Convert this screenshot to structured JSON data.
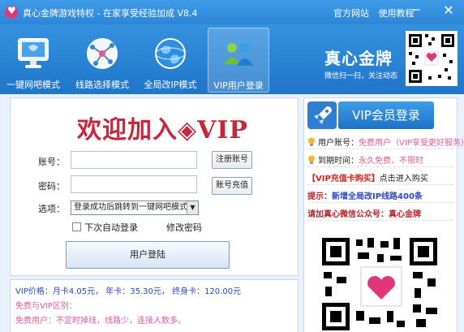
{
  "window": {
    "title": "真心金牌游戏特权 - 在家享受经验加成 V8.4",
    "links": [
      "官方网站",
      "使用教程"
    ],
    "minimize_glyph": "─",
    "close_glyph": "✕"
  },
  "toolbar": {
    "items": [
      {
        "label": "一键网吧模式",
        "icon": "monitor-icon"
      },
      {
        "label": "线路选择模式",
        "icon": "route-nodes-icon"
      },
      {
        "label": "全局改IP模式",
        "icon": "globe-icon"
      },
      {
        "label": "VIP用户登录",
        "icon": "vip-users-icon",
        "active": true
      }
    ],
    "brand_name": "真心金牌",
    "brand_sub": "微信扫一扫，关注动态"
  },
  "login": {
    "welcome": "欢迎加入◈VIP",
    "account_label": "账号：",
    "password_label": "密码：",
    "option_label": "选项：",
    "register_button": "注册账号",
    "recharge_button": "账号充值",
    "option_value": "登录成功后跳转到一键网吧模式",
    "auto_login_label": "下次自动登录",
    "change_password": "修改密码",
    "login_button": "用户登陆"
  },
  "price": {
    "line1": "VIP价格：月卡4.05元，    年卡：35.30元，    终身卡：120.00元",
    "line2": "免费与VIP区别：",
    "line3": "免费用户：不定时掉线，线路少，连接人数多。"
  },
  "vip_panel": {
    "login_button": "VIP会员登录",
    "account_label": "用户账号：",
    "account_value": "免费用户（VIP享受更好服务）",
    "expire_label": "到期时间：",
    "expire_value": "永久免费、不限时",
    "recharge_tag": "【VIP充值卡购买】",
    "recharge_link": "点击进入购买",
    "tip_label": "提示：",
    "tip_value": "新增全局改IP线路400条",
    "wechat_label": "请加真心微信公众号：",
    "wechat_value": "真心金牌"
  },
  "colors": {
    "accent_blue": "#2d86d6",
    "welcome_red": "#c4283d",
    "link_red": "#d7231e",
    "free_pink": "#e25a8e"
  }
}
